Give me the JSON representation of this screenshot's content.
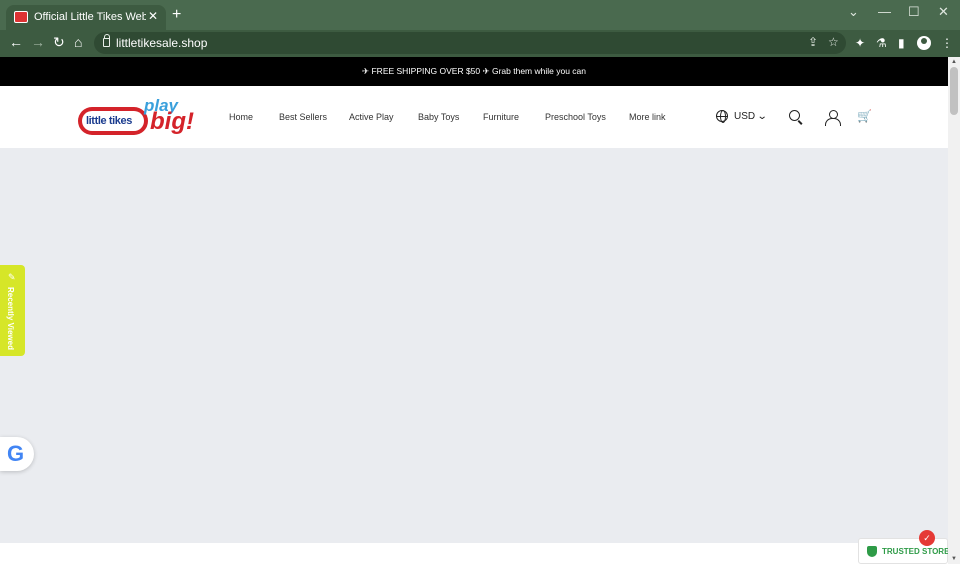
{
  "browser": {
    "tab_title": "Official Little Tikes Website | Par",
    "tab_close": "✕",
    "new_tab": "+",
    "url": "littletikesale.shop",
    "minimize": "—",
    "maximize": "☐",
    "close": "✕",
    "dropdown": "⌄",
    "back": "←",
    "forward": "→",
    "reload": "↻",
    "home": "⌂",
    "share": "⇪",
    "star": "☆",
    "extensions": "✦",
    "labs": "⚗",
    "sidepanel": "▮",
    "menu": "⋮"
  },
  "announcement": {
    "text": "✈ FREE SHIPPING OVER $50 ✈ Grab them while you can"
  },
  "logo": {
    "text": "little tikes",
    "play": "play",
    "big": "big!"
  },
  "nav": {
    "items": [
      {
        "label": "Home"
      },
      {
        "label": "Best Sellers"
      },
      {
        "label": "Active Play"
      },
      {
        "label": "Baby Toys"
      },
      {
        "label": "Furniture"
      },
      {
        "label": "Preschool Toys"
      },
      {
        "label": "More link"
      }
    ]
  },
  "header_actions": {
    "currency": "USD",
    "chevron": "⌄",
    "cart": "🛒"
  },
  "widgets": {
    "recently_viewed": "Recently Viewed",
    "recently_viewed_icon": "✎",
    "google_letter": "G",
    "trusted_store": "TRUSTED STORE"
  },
  "scroll": {
    "up": "▲",
    "down": "▼"
  },
  "colors": {
    "chrome_titlebar": "#4a6a4f",
    "chrome_toolbar": "#3d5b41",
    "announcement_bg": "#000000",
    "page_bg": "#eaecf0",
    "recently_viewed_bg": "#d6e628",
    "trusted_green": "#2e9b47",
    "logo_red": "#d4232a",
    "logo_blue": "#3aa0dc"
  }
}
